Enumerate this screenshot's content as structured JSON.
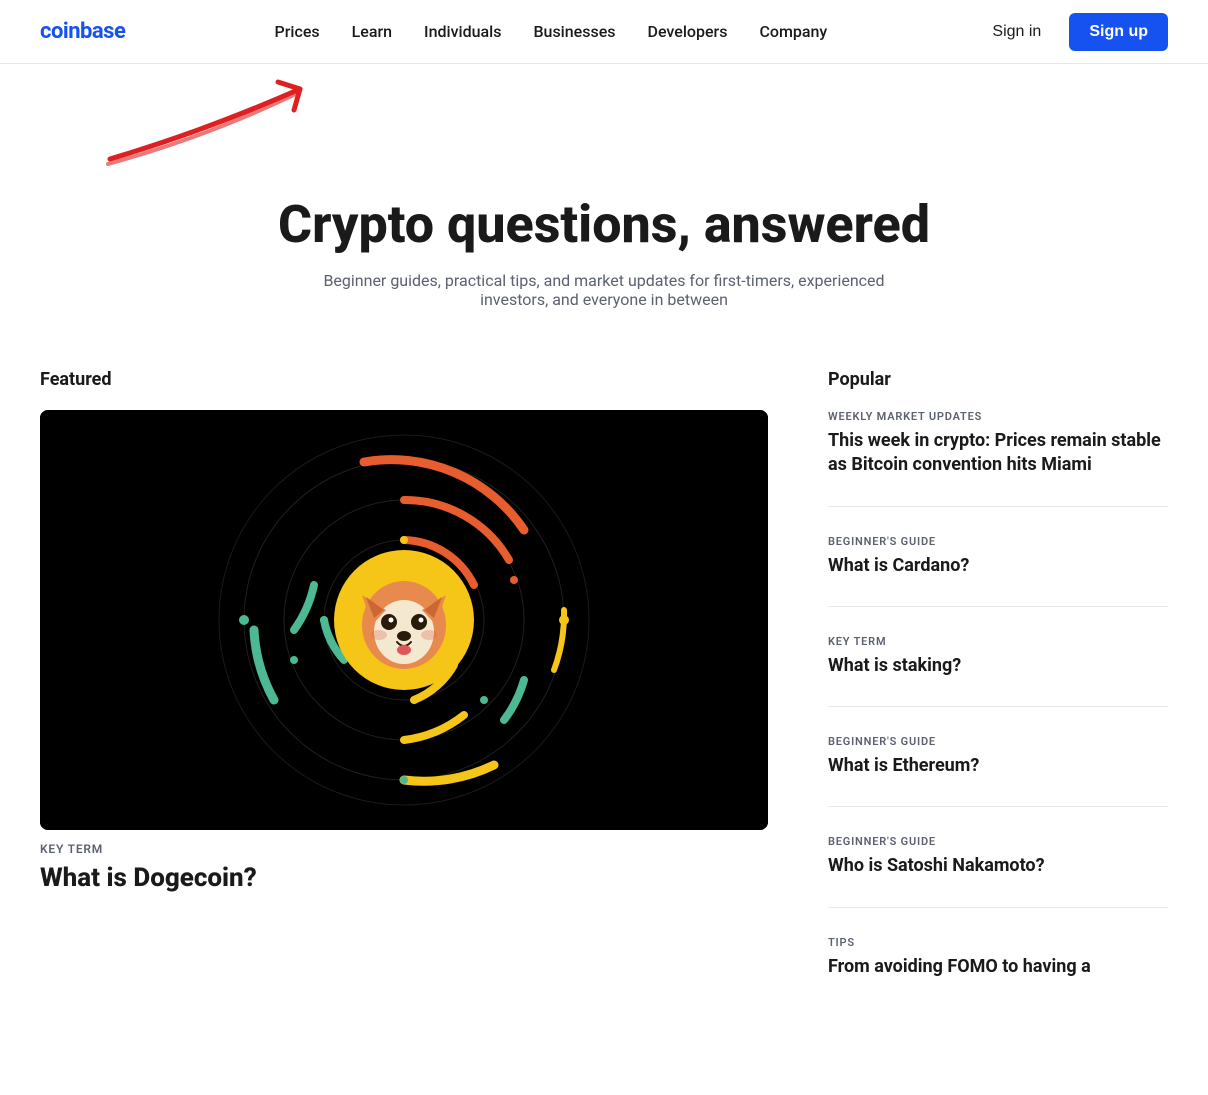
{
  "brand": {
    "logo": "coinbase",
    "logo_color": "#1652f0"
  },
  "nav": {
    "links": [
      {
        "id": "prices",
        "label": "Prices"
      },
      {
        "id": "learn",
        "label": "Learn"
      },
      {
        "id": "individuals",
        "label": "Individuals"
      },
      {
        "id": "businesses",
        "label": "Businesses"
      },
      {
        "id": "developers",
        "label": "Developers"
      },
      {
        "id": "company",
        "label": "Company"
      }
    ],
    "signin_label": "Sign in",
    "signup_label": "Sign up"
  },
  "hero": {
    "title": "Crypto questions, answered",
    "subtitle": "Beginner guides, practical tips, and market updates for first-timers, experienced investors, and everyone in between"
  },
  "featured": {
    "section_label": "Featured",
    "article_tag": "KEY TERM",
    "article_title": "What is Dogecoin?"
  },
  "popular": {
    "section_label": "Popular",
    "items": [
      {
        "tag": "WEEKLY MARKET UPDATES",
        "title": "This week in crypto: Prices remain stable as Bitcoin convention hits Miami"
      },
      {
        "tag": "BEGINNER'S GUIDE",
        "title": "What is Cardano?"
      },
      {
        "tag": "KEY TERM",
        "title": "What is staking?"
      },
      {
        "tag": "BEGINNER'S GUIDE",
        "title": "What is Ethereum?"
      },
      {
        "tag": "BEGINNER'S GUIDE",
        "title": "Who is Satoshi Nakamoto?"
      },
      {
        "tag": "TIPS",
        "title": "From avoiding FOMO to having a"
      }
    ]
  }
}
